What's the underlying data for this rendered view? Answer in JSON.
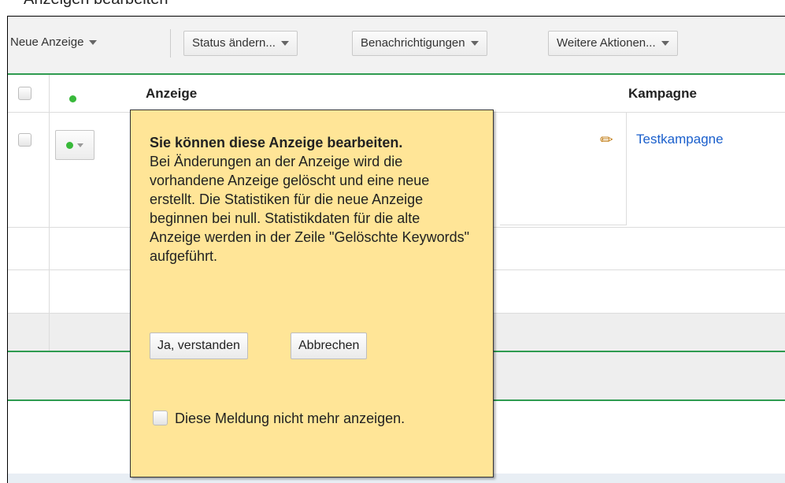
{
  "page_title_fragment": "Anzeigen bearbeiten",
  "toolbar": {
    "new_ad_label": "Neue Anzeige",
    "change_status_label": "Status ändern...",
    "notifications_label": "Benachrichtigungen",
    "more_actions_label": "Weitere Aktionen..."
  },
  "table": {
    "headers": {
      "ad": "Anzeige",
      "campaign": "Kampagne"
    },
    "rows": [
      {
        "campaign": "Testkampagne",
        "status_color": "#38b93a"
      }
    ]
  },
  "tooltip": {
    "title": "Sie können diese Anzeige bearbeiten.",
    "body": "Bei Änderungen an der Anzeige wird die vorhandene Anzeige gelöscht und eine neue erstellt. Die Statistiken für die neue Anzeige beginnen bei null. Statistikdaten für die alte Anzeige werden in der Zeile \"Gelöschte Keywords\" aufgeführt.",
    "confirm_label": "Ja, verstanden",
    "cancel_label": "Abbrechen",
    "dont_show_label": "Diese Meldung nicht mehr anzeigen."
  },
  "colors": {
    "accent_green": "#2f9b50",
    "link_blue": "#1a5fcc",
    "tooltip_bg": "#ffe597",
    "status_green": "#38b93a"
  },
  "icons": {
    "edit": "pencil-icon",
    "dropdown": "chevron-down-icon",
    "status": "status-dot-icon"
  }
}
